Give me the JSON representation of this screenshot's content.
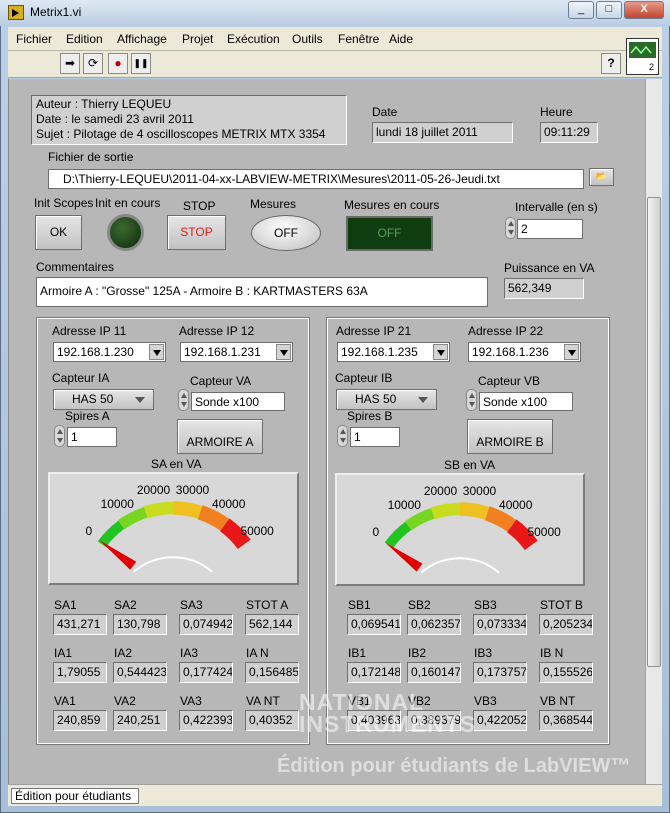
{
  "window": {
    "title": "Metrix1.vi",
    "min": "_",
    "max": "□",
    "close": "X"
  },
  "menu": [
    "Fichier",
    "Edition",
    "Affichage",
    "Projet",
    "Exécution",
    "Outils",
    "Fenêtre",
    "Aide"
  ],
  "toolbar": {
    "run": "➡",
    "run_cont": "⟳",
    "abort": "●",
    "pause": "❚❚",
    "help": "?"
  },
  "info": {
    "author": "Auteur : Thierry LEQUEU",
    "date": "Date     : le samedi 23 avril 2011",
    "subject": "Sujet    : Pilotage de 4 oscilloscopes METRIX MTX 3354"
  },
  "date": {
    "label": "Date",
    "value": "lundi 18 juillet 2011"
  },
  "time": {
    "label": "Heure",
    "value": "09:11:29"
  },
  "output": {
    "label": "Fichier de sortie",
    "path": "D:\\Thierry-LEQUEU\\2011-04-xx-LABVIEW-METRIX\\Mesures\\2011-05-26-Jeudi.txt"
  },
  "controls": {
    "init_scopes": "Init Scopes",
    "ok": "OK",
    "init_running": "Init en cours",
    "stop_label": "STOP",
    "stop_btn": "STOP",
    "mesures": "Mesures",
    "mesures_btn": "OFF",
    "mesures_running": "Mesures en cours",
    "mesures_led": "OFF",
    "interval_label": "Intervalle (en s)",
    "interval": "2"
  },
  "comments": {
    "label": "Commentaires",
    "value": "Armoire A : \"Grosse\" 125A - Armoire B : KARTMASTERS 63A"
  },
  "power": {
    "label": "Puissance en VA",
    "value": "562,349"
  },
  "cabinet_a": {
    "ip1_label": "Adresse IP 11",
    "ip1": "192.168.1.230",
    "ip2_label": "Adresse IP 12",
    "ip2": "192.168.1.231",
    "sensor_i_label": "Capteur IA",
    "sensor_i": "HAS 50",
    "sensor_v_label": "Capteur VA",
    "sensor_v": "Sonde x100",
    "turns_label": "Spires A",
    "turns": "1",
    "btn": "ARMOIRE A",
    "gauge_label": "SA en VA",
    "gauge_value": 562,
    "ticks": [
      "0",
      "10000",
      "20000",
      "30000",
      "40000",
      "50000"
    ],
    "s_labels": [
      "SA1",
      "SA2",
      "SA3",
      "STOT A"
    ],
    "s": [
      "431,271",
      "130,798",
      "0,074942",
      "562,144"
    ],
    "i_labels": [
      "IA1",
      "IA2",
      "IA3",
      "IA N"
    ],
    "i": [
      "1,79055",
      "0,544423",
      "0,177424",
      "0,156485"
    ],
    "v_labels": [
      "VA1",
      "VA2",
      "VA3",
      "VA NT"
    ],
    "v": [
      "240,859",
      "240,251",
      "0,422393",
      "0,40352"
    ]
  },
  "cabinet_b": {
    "ip1_label": "Adresse IP 21",
    "ip1": "192.168.1.235",
    "ip2_label": "Adresse IP 22",
    "ip2": "192.168.1.236",
    "sensor_i_label": "Capteur IB",
    "sensor_i": "HAS 50",
    "sensor_v_label": "Capteur VB",
    "sensor_v": "Sonde x100",
    "turns_label": "Spires B",
    "turns": "1",
    "btn": "ARMOIRE B",
    "gauge_label": "SB en VA",
    "gauge_value": 0.2,
    "ticks": [
      "0",
      "10000",
      "20000",
      "30000",
      "40000",
      "50000"
    ],
    "s_labels": [
      "SB1",
      "SB2",
      "SB3",
      "STOT B"
    ],
    "s": [
      "0,069541",
      "0,062357",
      "0,073334",
      "0,205234"
    ],
    "i_labels": [
      "IB1",
      "IB2",
      "IB3",
      "IB N"
    ],
    "i": [
      "0,172148",
      "0,160147",
      "0,173757",
      "0,155526"
    ],
    "v_labels": [
      "VB1",
      "VB2",
      "VB3",
      "VB NT"
    ],
    "v": [
      "0,403963",
      "0,389379",
      "0,422052",
      "0,368544"
    ]
  },
  "watermark": {
    "brand1": "NATIONAL",
    "brand2": "INSTRUMENTS",
    "edition": "Édition pour étudiants de LabVIEW™"
  },
  "status": "Édition pour étudiants"
}
